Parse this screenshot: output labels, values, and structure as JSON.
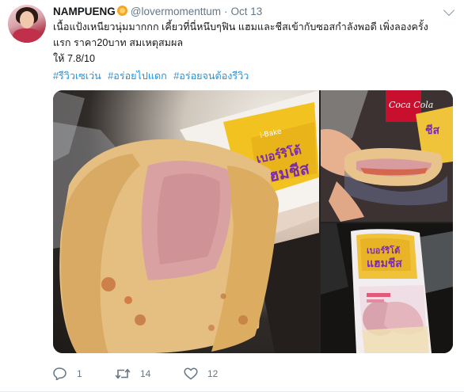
{
  "tweet": {
    "author_name": "NAMPUENG",
    "author_handle": "@lovermomenttum",
    "separator": "·",
    "date": "Oct 13",
    "text_lines": [
      "เนื้อแป้งเหนียวนุ่มมากกก เคี้ยวที่นี่หนึบๆฟิน แฮมและชีสเข้ากับซอสกำลังพอดี เพิ่งลองครั้ง",
      "แรก ราคา20บาท สมเหตุสมผล",
      "ให้ 7.8/10"
    ],
    "hashtags": [
      "#รีวิวเซเว่น",
      "#อร่อยไปแดก",
      "#อร่อยจนต้องรีวิว"
    ],
    "media": {
      "main_package_text_line1": "เบอร์ริโต้",
      "main_package_text_line2": "แฮมชีส",
      "main_brand": "i-Bake",
      "tr_can_text": "Coca Cola",
      "tr_package_text": "ชีส",
      "br_package_text_line1": "เบอร์ริโต้",
      "br_package_text_line2": "แฮมชีส"
    },
    "actions": {
      "reply_count": "1",
      "retweet_count": "14",
      "like_count": "12"
    }
  },
  "icons": {
    "reply": "reply-icon",
    "retweet": "retweet-icon",
    "like": "heart-icon",
    "menu": "chevron-down-icon"
  },
  "colors": {
    "link": "#1b95e0",
    "muted": "#657786",
    "text": "#14171a"
  }
}
